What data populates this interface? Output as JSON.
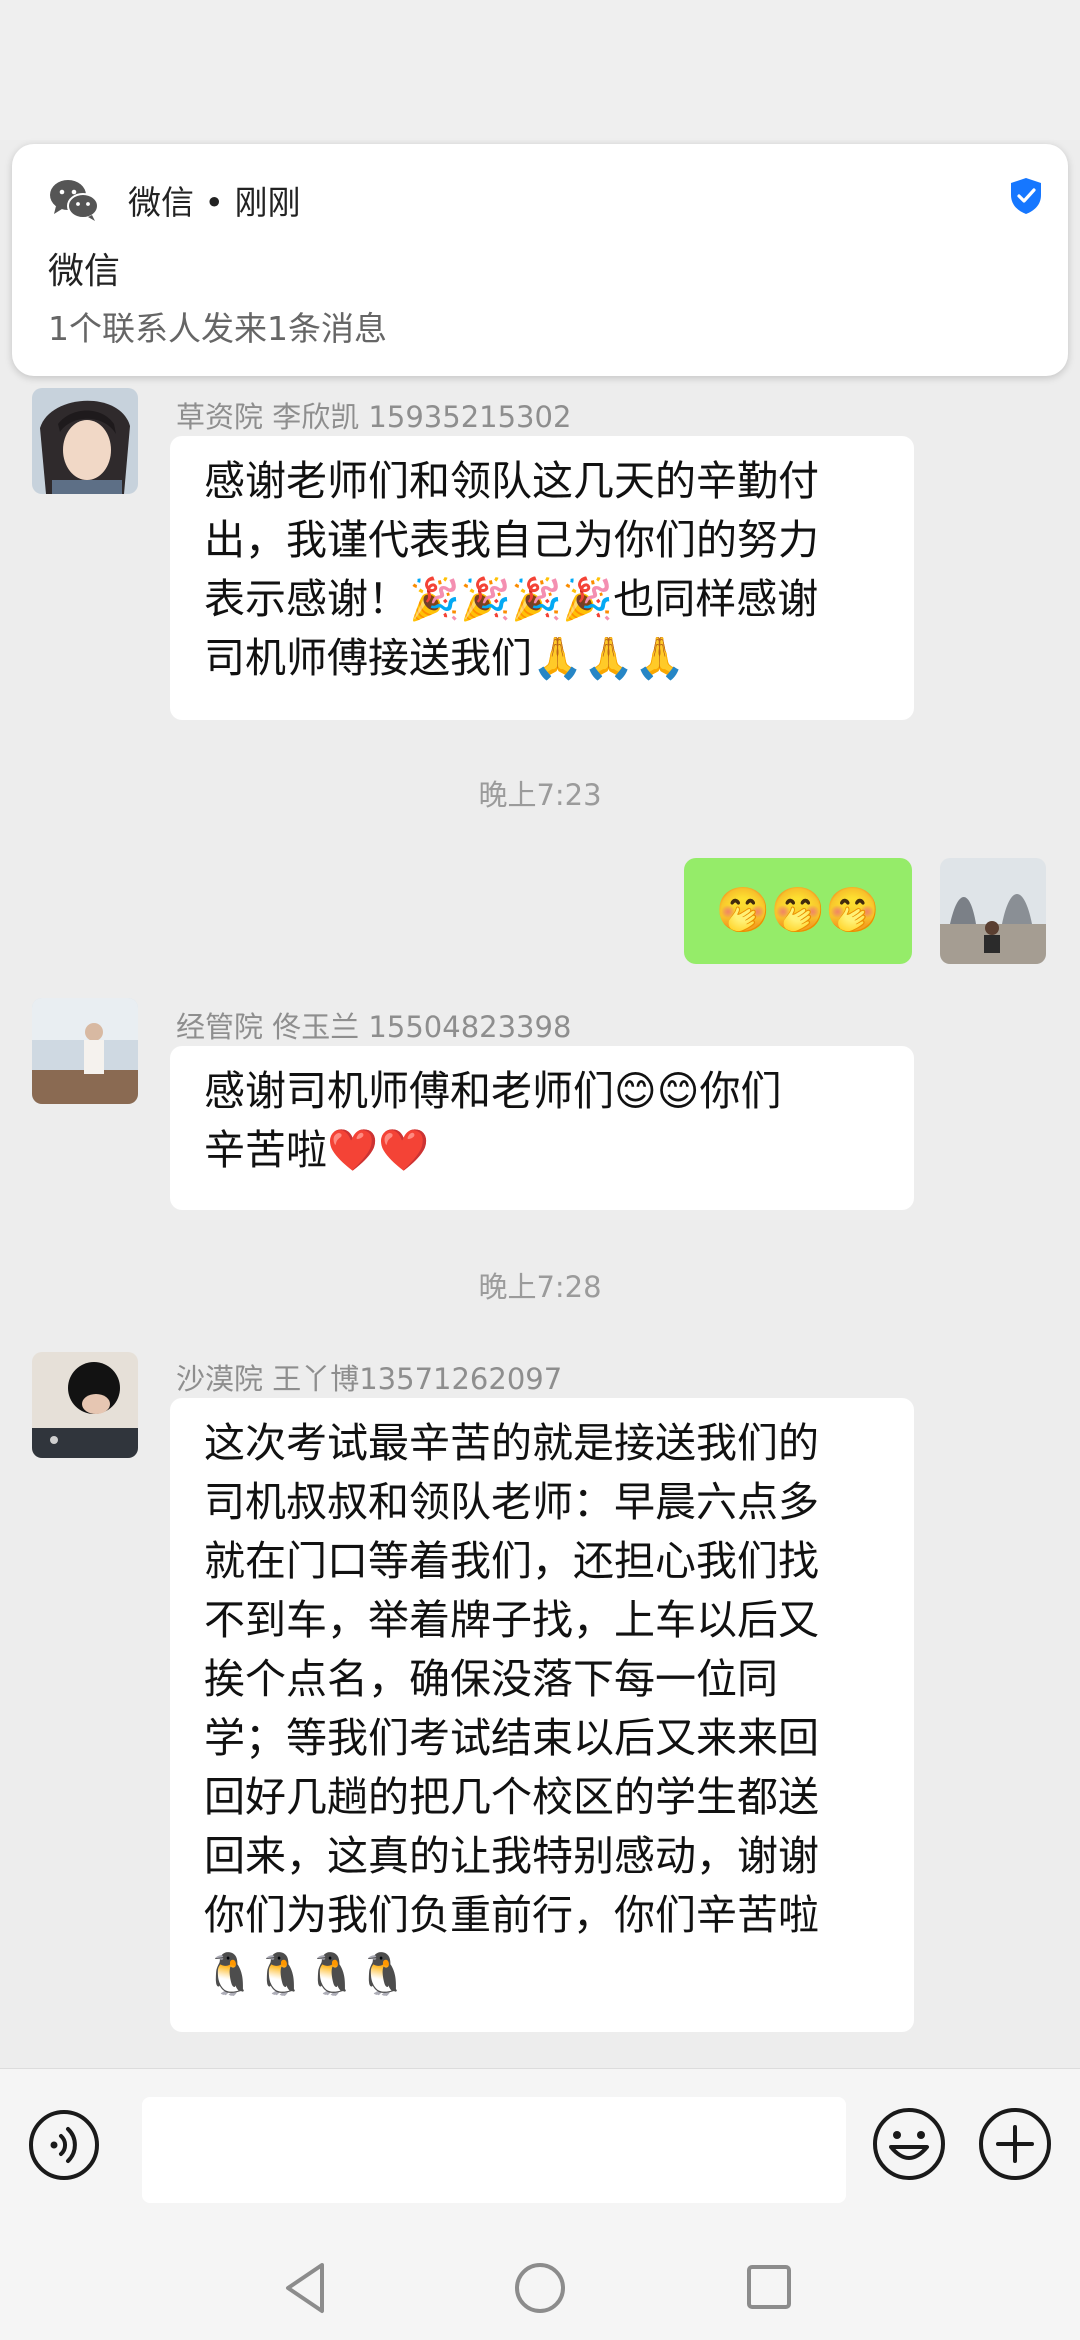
{
  "notification": {
    "app_line": "微信 • 刚刚",
    "title": "微信",
    "body": "1个联系人发来1条消息"
  },
  "messages": [
    {
      "sender": "草资院 李欣凯 15935215302",
      "lines": [
        "感谢老师们和领队这几天的辛勤付",
        "出，我谨代表我自己为你们的努力",
        "表示感谢！🎉🎉🎉🎉也同样感谢",
        "司机师傅接送我们🙏🙏🙏"
      ]
    },
    {
      "timestamp": "晚上7:23"
    },
    {
      "outgoing": "🤭🤭🤭"
    },
    {
      "sender": "经管院 佟玉兰 15504823398",
      "lines": [
        "感谢司机师傅和老师们😊😊你们",
        "辛苦啦❤️❤️"
      ]
    },
    {
      "timestamp": "晚上7:28"
    },
    {
      "sender": "沙漠院 王丫博13571262097",
      "lines": [
        "这次考试最辛苦的就是接送我们的",
        "司机叔叔和领队老师：早晨六点多",
        "就在门口等着我们，还担心我们找",
        "不到车，举着牌子找，上车以后又",
        "挨个点名，确保没落下每一位同",
        "学；等我们考试结束以后又来来回",
        "回好几趟的把几个校区的学生都送",
        "回来，这真的让我特别感动，谢谢",
        "你们为我们负重前行，你们辛苦啦",
        "🐧🐧🐧🐧"
      ]
    }
  ],
  "input": {
    "value": ""
  },
  "icons": {
    "notif_app": "wechat-icon",
    "verified": "verified-shield-icon",
    "voice": "voice-input-icon",
    "emoji": "emoji-icon",
    "more": "plus-icon",
    "nav_back": "nav-back-icon",
    "nav_home": "nav-home-icon",
    "nav_recent": "nav-recent-icon"
  },
  "colors": {
    "background": "#ededed",
    "incoming_bubble": "#ffffff",
    "outgoing_bubble": "#95ec69",
    "verified_blue": "#1677ff"
  }
}
